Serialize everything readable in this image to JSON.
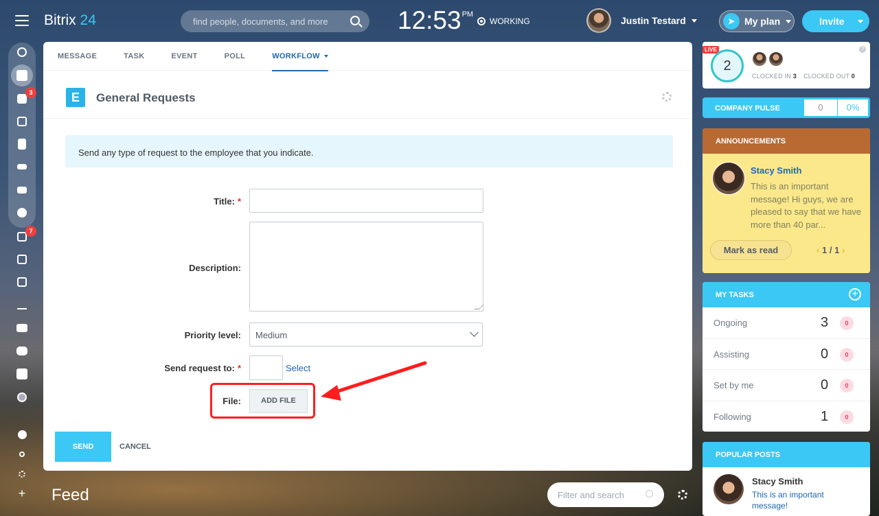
{
  "app": {
    "logo_text": "Bitrix",
    "logo_num": "24"
  },
  "header": {
    "search_placeholder": "find people, documents, and more",
    "clock": "12:53",
    "clock_suffix": "PM",
    "status": "WORKING",
    "user_name": "Justin Testard",
    "my_plan": "My plan",
    "invite": "Invite"
  },
  "sidebar": {
    "badge_chats": "3",
    "badge_tasks": "7"
  },
  "composer": {
    "tabs": [
      "MESSAGE",
      "TASK",
      "EVENT",
      "POLL",
      "WORKFLOW"
    ],
    "active_tab": "WORKFLOW",
    "workflow_icon": "E",
    "workflow_title": "General Requests",
    "info": "Send any type of request to the employee that you indicate.",
    "fields": {
      "title_label": "Title:",
      "description_label": "Description:",
      "priority_label": "Priority level:",
      "priority_value": "Medium",
      "send_to_label": "Send request to:",
      "select_link": "Select",
      "file_label": "File:",
      "add_file": "ADD FILE",
      "required_mark": "*"
    },
    "send": "SEND",
    "cancel": "CANCEL"
  },
  "footer": {
    "feed": "Feed",
    "filter_placeholder": "Filter and search"
  },
  "right": {
    "live_badge": "LIVE",
    "clock_count": "2",
    "clocked_in_label": "CLOCKED IN",
    "clocked_in": "3",
    "clocked_out_label": "CLOCKED OUT",
    "clocked_out": "0",
    "help": "?",
    "pulse_label": "COMPANY PULSE",
    "pulse_value": "0",
    "pulse_percent": "0%",
    "announcements": {
      "title": "ANNOUNCEMENTS",
      "author": "Stacy Smith",
      "message": "This is an important message! Hi guys, we are pleased to say that we have more than 40 par...",
      "mark_read": "Mark as read",
      "page": "1",
      "total": "1",
      "sep": "/"
    },
    "tasks": {
      "title": "MY TASKS",
      "rows": [
        {
          "label": "Ongoing",
          "count": "3",
          "badge": "0"
        },
        {
          "label": "Assisting",
          "count": "0",
          "badge": "0"
        },
        {
          "label": "Set by me",
          "count": "0",
          "badge": "0"
        },
        {
          "label": "Following",
          "count": "1",
          "badge": "0"
        }
      ]
    },
    "popular": {
      "title": "POPULAR POSTS",
      "author": "Stacy Smith",
      "message": "This is an important message!"
    }
  }
}
